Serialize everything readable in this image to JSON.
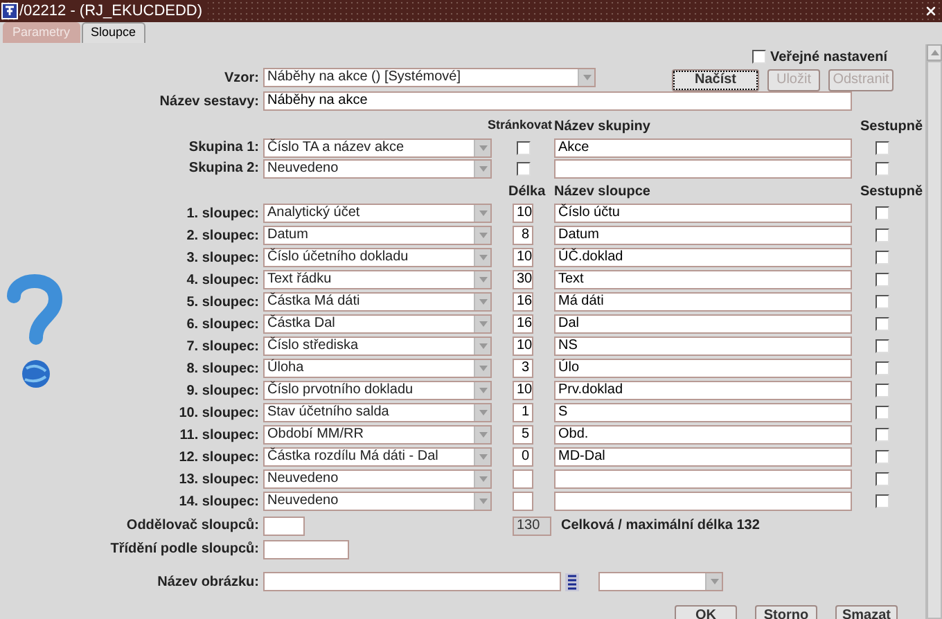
{
  "window": {
    "title": "/02212 - (RJ_EKUCDEDD)"
  },
  "tabs": [
    {
      "label": "Parametry",
      "selected": false
    },
    {
      "label": "Sloupce",
      "selected": true
    }
  ],
  "public_setting": {
    "label": "Veřejné nastavení",
    "checked": false
  },
  "template": {
    "label": "Vzor:",
    "value": "Náběhy na akce   ()   [Systémové]"
  },
  "top_buttons": [
    {
      "label": "Načíst",
      "disabled": false
    },
    {
      "label": "Uložit",
      "disabled": true
    },
    {
      "label": "Odstranit",
      "disabled": true
    }
  ],
  "report_name": {
    "label": "Název sestavy:",
    "value": "Náběhy na akce"
  },
  "group_headers": {
    "paging": "Stránkovat",
    "name": "Název skupiny",
    "descending": "Sestupně"
  },
  "groups": [
    {
      "label": "Skupina 1:",
      "value": "Číslo TA a název akce",
      "paging": false,
      "name": "Akce",
      "descending": false
    },
    {
      "label": "Skupina 2:",
      "value": "Neuvedeno",
      "paging": false,
      "descending": false
    }
  ],
  "column_headers": {
    "length": "Délka",
    "name": "Název sloupce",
    "descending": "Sestupně"
  },
  "columns": [
    {
      "label": "1. sloupec:",
      "value": "Analytický účet",
      "length": "10",
      "name": "Číslo účtu",
      "descending": false
    },
    {
      "label": "2. sloupec:",
      "value": "Datum",
      "length": "8",
      "name": "Datum",
      "descending": false
    },
    {
      "label": "3. sloupec:",
      "value": "Číslo účetního dokladu",
      "length": "10",
      "name": "ÚČ.doklad",
      "descending": false
    },
    {
      "label": "4. sloupec:",
      "value": "Text řádku",
      "length": "30",
      "name": "Text",
      "descending": false
    },
    {
      "label": "5. sloupec:",
      "value": "Částka Má dáti",
      "length": "16",
      "name": "Má dáti",
      "descending": false
    },
    {
      "label": "6. sloupec:",
      "value": "Částka Dal",
      "length": "16",
      "name": "Dal",
      "descending": false
    },
    {
      "label": "7. sloupec:",
      "value": "Číslo střediska",
      "length": "10",
      "name": "NS",
      "descending": false
    },
    {
      "label": "8. sloupec:",
      "value": "Úloha",
      "length": "3",
      "name": "Úlo",
      "descending": false
    },
    {
      "label": "9. sloupec:",
      "value": "Číslo prvotního dokladu",
      "length": "10",
      "name": "Prv.doklad",
      "descending": false
    },
    {
      "label": "10. sloupec:",
      "value": "Stav účetního salda",
      "length": "1",
      "name": "S",
      "descending": false
    },
    {
      "label": "11. sloupec:",
      "value": "Období MM/RR",
      "length": "5",
      "name": "Obd.",
      "descending": false
    },
    {
      "label": "12. sloupec:",
      "value": "Částka rozdílu Má dáti - Dal",
      "length": "0",
      "name": "MD-Dal",
      "descending": false
    },
    {
      "label": "13. sloupec:",
      "value": "Neuvedeno",
      "descending": false
    },
    {
      "label": "14. sloupec:",
      "value": "Neuvedeno",
      "descending": false
    }
  ],
  "separator": {
    "label": "Oddělovač sloupců:"
  },
  "total": {
    "value": "130",
    "text": "Celková / maximální délka 132"
  },
  "sort": {
    "label": "Třídění podle sloupců:"
  },
  "image": {
    "label": "Název obrázku:"
  },
  "bottom_buttons": [
    {
      "label": "OK"
    },
    {
      "label": "Storno"
    },
    {
      "label": "Smazat"
    }
  ]
}
